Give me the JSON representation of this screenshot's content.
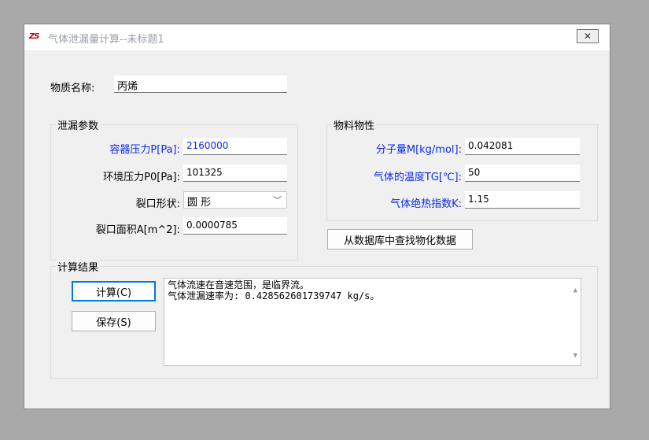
{
  "window": {
    "app_icon_text": "ZS",
    "title": "气体泄漏量计算--未标题1",
    "close_glyph": "✕"
  },
  "substance": {
    "label": "物质名称:",
    "value": "丙烯"
  },
  "leak_params": {
    "group_title": "泄漏参数",
    "container_pressure_label": "容器压力P[Pa]:",
    "container_pressure_value": "2160000",
    "ambient_pressure_label": "环境压力P0[Pa]:",
    "ambient_pressure_value": "101325",
    "crack_shape_label": "裂口形状:",
    "crack_shape_value": "圆 形",
    "crack_area_label": "裂口面积A[m^2]:",
    "crack_area_value": "0.0000785"
  },
  "material_props": {
    "group_title": "物料物性",
    "molecular_weight_label": "分子量M[kg/mol]:",
    "molecular_weight_value": "0.042081",
    "gas_temp_label": "气体的温度TG[℃]:",
    "gas_temp_value": "50",
    "adiabatic_index_label": "气体绝热指数K:",
    "adiabatic_index_value": "1.15",
    "lookup_button": "从数据库中查找物化数据"
  },
  "results": {
    "group_title": "计算结果",
    "calculate_button": "计算(C)",
    "save_button": "保存(S)",
    "line1": "气体流速在音速范围，是临界流。",
    "line2": "气体泄漏速率为: 0.428562601739747 kg/s。"
  },
  "icons": {
    "chevron_down": "﹀",
    "scroll_up": "▲",
    "scroll_down": "▼"
  }
}
